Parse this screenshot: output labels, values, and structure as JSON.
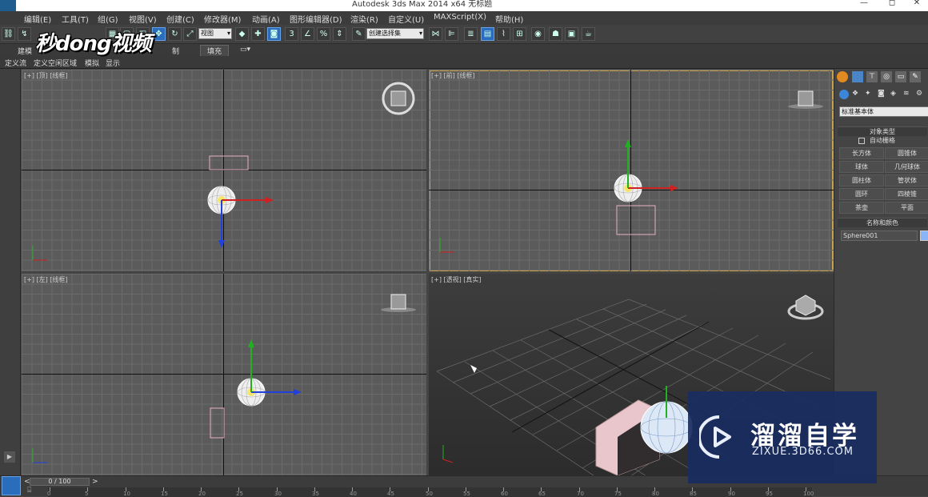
{
  "window": {
    "title": "Autodesk 3ds Max  2014 x64      无标题",
    "minimize": "—",
    "maximize": "◻",
    "close": "✕"
  },
  "menu": [
    {
      "label": "编辑(E)",
      "name": "menu-edit"
    },
    {
      "label": "工具(T)",
      "name": "menu-tools"
    },
    {
      "label": "组(G)",
      "name": "menu-group"
    },
    {
      "label": "视图(V)",
      "name": "menu-views"
    },
    {
      "label": "创建(C)",
      "name": "menu-create"
    },
    {
      "label": "修改器(M)",
      "name": "menu-modifiers"
    },
    {
      "label": "动画(A)",
      "name": "menu-animation"
    },
    {
      "label": "图形编辑器(D)",
      "name": "menu-graph-editors"
    },
    {
      "label": "渲染(R)",
      "name": "menu-rendering"
    },
    {
      "label": "自定义(U)",
      "name": "menu-customize"
    },
    {
      "label": "MAXScript(X)",
      "name": "menu-maxscript"
    },
    {
      "label": "帮助(H)",
      "name": "menu-help"
    }
  ],
  "toolbar": {
    "view_dropdown": "视图",
    "selection_set_dropdown": "创建选择集"
  },
  "ribbon": {
    "tab_modeling": "建模",
    "tab_freeform_suffix": "制",
    "tab_populate": "填充",
    "sub_items": [
      "定义流",
      "定义空闲区域",
      "模拟",
      "显示"
    ]
  },
  "viewports": {
    "top": {
      "label": "[+] [顶] [线框]"
    },
    "front": {
      "label": "[+] [前] [线框]"
    },
    "left": {
      "label": "[+] [左] [线框]"
    },
    "perspective": {
      "label": "[+] [透视] [真实]"
    }
  },
  "command_panel": {
    "category_dropdown": "标准基本体",
    "object_type_header": "对象类型",
    "autogrid_label": "自动栅格",
    "primitives": [
      "长方体",
      "圆锥体",
      "球体",
      "几何球体",
      "圆柱体",
      "管状体",
      "圆环",
      "四棱锥",
      "茶壶",
      "平面"
    ],
    "name_color_header": "名称和颜色",
    "object_name": "Sphere001",
    "object_color": "#8ab4f8"
  },
  "timeline": {
    "frame_counter": "0 / 100",
    "prev": "<",
    "next": ">",
    "ticks": [
      "0",
      "5",
      "10",
      "15",
      "20",
      "25",
      "30",
      "35",
      "40",
      "45",
      "50",
      "55",
      "60",
      "65",
      "70",
      "75",
      "80",
      "85",
      "90",
      "95",
      "100"
    ]
  },
  "watermarks": {
    "top_left": "秒dong视频",
    "bottom_right_title": "溜溜自学",
    "bottom_right_url": "ZIXUE.3D66.COM"
  },
  "colors": {
    "accent_active": "#2a6dbd",
    "active_viewport_border": "#c8a24a",
    "axis_x": "#d02020",
    "axis_y": "#20b020",
    "axis_z": "#2040e0"
  }
}
